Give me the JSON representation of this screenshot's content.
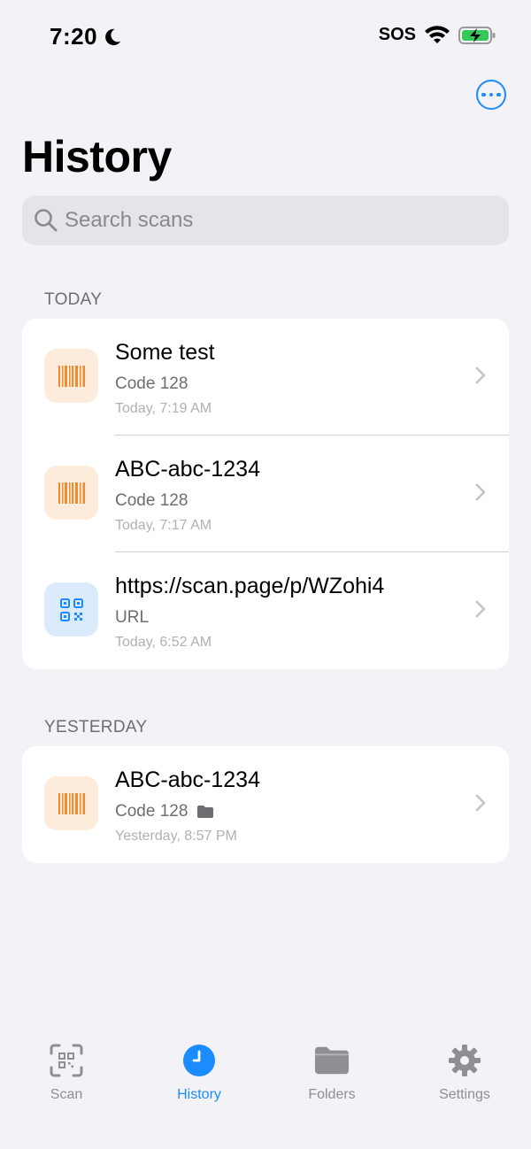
{
  "status_bar": {
    "time": "7:20",
    "carrier": "SOS"
  },
  "header": {
    "title": "History",
    "more_icon": "ellipsis-circle-icon"
  },
  "search": {
    "placeholder": "Search scans"
  },
  "sections": [
    {
      "header": "TODAY",
      "items": [
        {
          "title": "Some test",
          "type": "Code 128",
          "time": "Today, 7:19 AM",
          "icon": "barcode-icon"
        },
        {
          "title": "ABC-abc-1234",
          "type": "Code 128",
          "time": "Today, 7:17 AM",
          "icon": "barcode-icon"
        },
        {
          "title": "https://scan.page/p/WZohi4",
          "type": "URL",
          "time": "Today, 6:52 AM",
          "icon": "qr-code-icon"
        }
      ]
    },
    {
      "header": "YESTERDAY",
      "items": [
        {
          "title": "ABC-abc-1234",
          "type": "Code 128",
          "time": "Yesterday, 8:57 PM",
          "icon": "barcode-icon",
          "in_folder": true
        }
      ]
    }
  ],
  "tabs": [
    {
      "label": "Scan",
      "icon": "qr-scan-icon",
      "active": false
    },
    {
      "label": "History",
      "icon": "clock-icon",
      "active": true
    },
    {
      "label": "Folders",
      "icon": "folder-icon",
      "active": false
    },
    {
      "label": "Settings",
      "icon": "gear-icon",
      "active": false
    }
  ],
  "colors": {
    "accent": "#1a8cff",
    "barcode": "#f08a2c",
    "qr": "#1a8cff"
  }
}
